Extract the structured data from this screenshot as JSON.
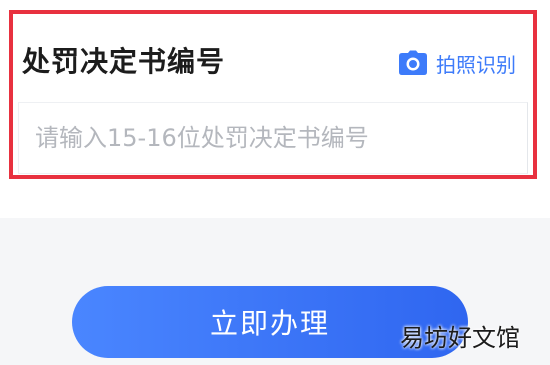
{
  "form": {
    "title": "处罚决定书编号",
    "photo_recognize_label": "拍照识别",
    "decision_number_placeholder": "请输入15-16位处罚决定书编号"
  },
  "actions": {
    "submit_label": "立即办理"
  },
  "watermark": {
    "text": "易坊好文馆"
  },
  "icons": {
    "photo": "camera-icon"
  },
  "colors": {
    "accent": "#3d7bfa",
    "highlight_border": "#e8313f",
    "button_start": "#4a86ff",
    "button_end": "#2f66f0",
    "title_text": "#1c1c1c",
    "placeholder_text": "#b4b7bd",
    "page_background": "#f5f6f8"
  }
}
